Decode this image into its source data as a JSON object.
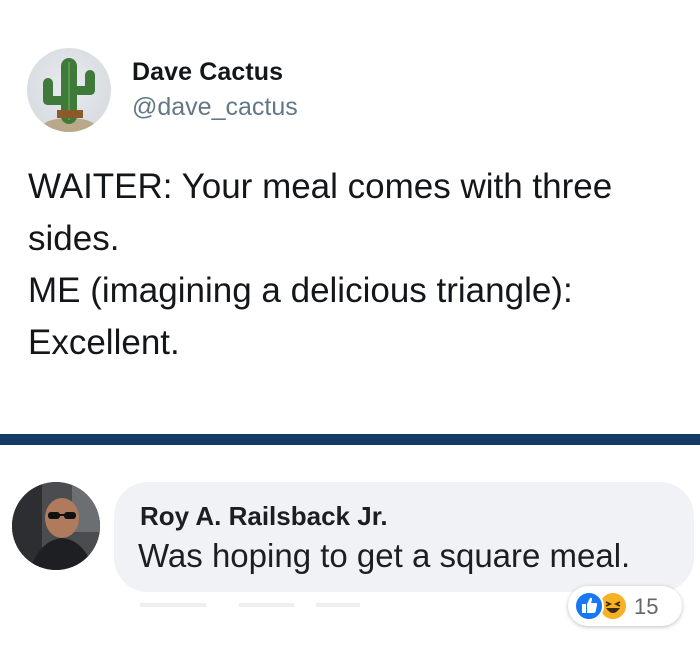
{
  "tweet": {
    "author_name": "Dave Cactus",
    "author_handle": "@dave_cactus",
    "avatar_icon": "cactus-avatar-icon",
    "lines": [
      "WAITER: Your meal comes with three",
      "sides.",
      "ME (imagining a delicious triangle):",
      "Excellent."
    ]
  },
  "divider": {
    "color": "#143a66"
  },
  "comment": {
    "author": "Roy A. Railsback Jr.",
    "text": "Was hoping to get a square meal.",
    "avatar_icon": "user-photo-avatar",
    "reactions": {
      "icons": [
        "like-icon",
        "haha-icon"
      ],
      "count": "15",
      "like_color": "#1877f2",
      "haha_color": "#f7b125"
    }
  }
}
